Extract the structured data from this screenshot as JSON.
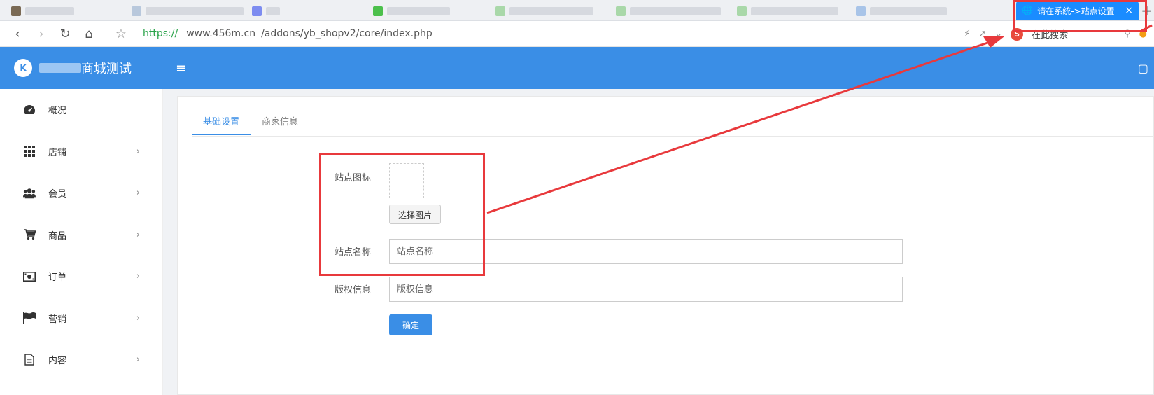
{
  "browser": {
    "active_tab_title": "请在系统->站点设置里",
    "url_protocol": "https://",
    "url_host": "www.456m.cn",
    "url_path": "/addons/yb_shopv2/core/index.php",
    "search_placeholder": "在此搜索"
  },
  "header": {
    "logo_text": "K",
    "brand_title": "商城测试",
    "menu_icon": "hamburger-icon"
  },
  "sidebar": {
    "items": [
      {
        "label": "概况",
        "icon": "dashboard-icon",
        "has_arrow": false
      },
      {
        "label": "店铺",
        "icon": "grid-icon",
        "has_arrow": true
      },
      {
        "label": "会员",
        "icon": "users-icon",
        "has_arrow": true
      },
      {
        "label": "商品",
        "icon": "cart-icon",
        "has_arrow": true
      },
      {
        "label": "订单",
        "icon": "money-icon",
        "has_arrow": true
      },
      {
        "label": "营销",
        "icon": "flag-icon",
        "has_arrow": true
      },
      {
        "label": "内容",
        "icon": "document-icon",
        "has_arrow": true
      }
    ],
    "arrow_glyph": "›"
  },
  "content": {
    "tabs": [
      {
        "label": "基础设置",
        "active": true
      },
      {
        "label": "商家信息",
        "active": false
      }
    ],
    "form": {
      "site_icon_label": "站点图标",
      "choose_image_button": "选择图片",
      "site_name_label": "站点名称",
      "site_name_placeholder": "站点名称",
      "copyright_label": "版权信息",
      "copyright_placeholder": "版权信息",
      "confirm_button": "确定"
    }
  },
  "colors": {
    "primary": "#3a8ee6",
    "annotation_red": "#e8393c"
  }
}
